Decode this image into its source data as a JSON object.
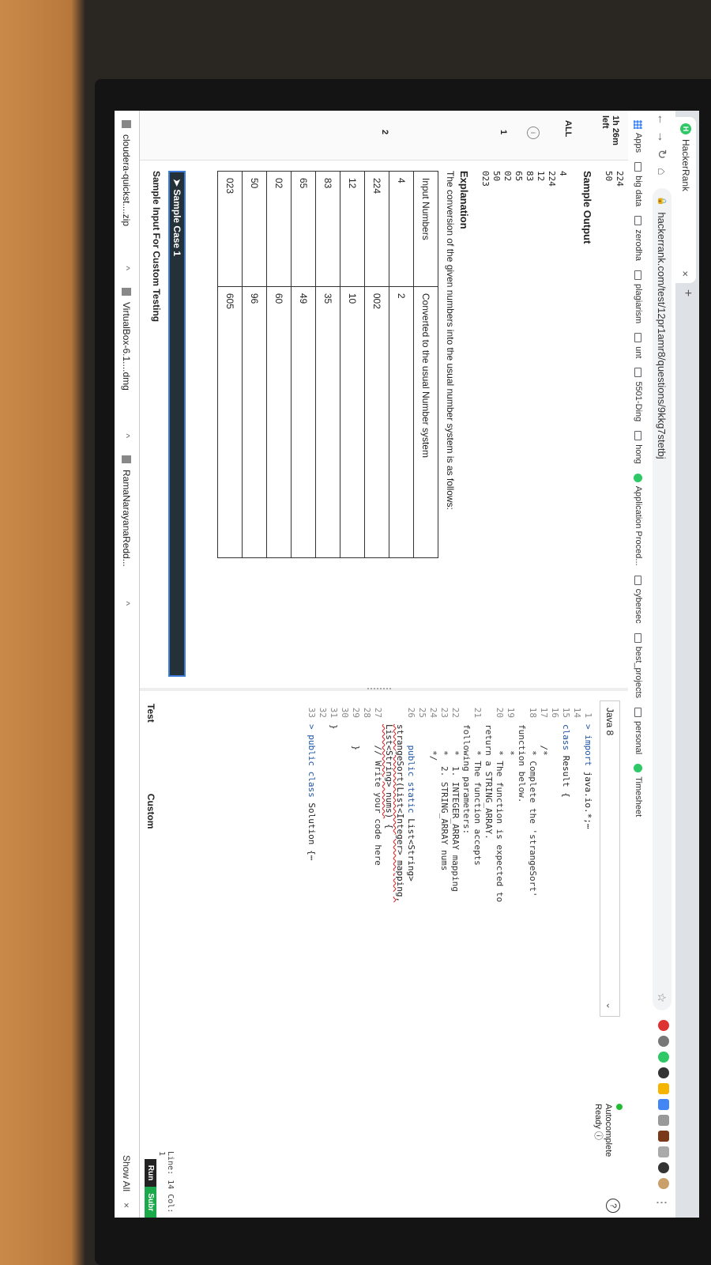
{
  "browser": {
    "tab_title": "HackerRank",
    "tab_close": "×",
    "new_tab": "+",
    "url": "hackerrank.com/test/12pr1amr8/questions/9kkg7stetbj",
    "bookmarks": [
      "Apps",
      "big data",
      "zerodha",
      "plagiarism",
      "unt",
      "5501-Ding",
      "hong",
      "Application Proced...",
      "cybersec",
      "best_projects",
      "personal",
      "Timesheet"
    ]
  },
  "sidebar": {
    "timer": "1h 26m",
    "timer_sub": "left",
    "all_label": "ALL",
    "q1": "1",
    "q2": "2"
  },
  "problem": {
    "top_lines": [
      "224",
      "50"
    ],
    "sample_output_label": "Sample Output",
    "sample_output": [
      "4",
      "224",
      "12",
      "83",
      "65",
      "02",
      "50",
      "023"
    ],
    "explanation_label": "Explanation",
    "explanation_text": "The conversion of the given numbers into the usual number system is as follows:",
    "table_headers": [
      "Input Numbers",
      "Converted to the usual Number system"
    ],
    "table_rows": [
      [
        "4",
        "2"
      ],
      [
        "224",
        "002"
      ],
      [
        "12",
        "10"
      ],
      [
        "83",
        "35"
      ],
      [
        "65",
        "49"
      ],
      [
        "02",
        "60"
      ],
      [
        "50",
        "96"
      ],
      [
        "023",
        "605"
      ]
    ],
    "sample_case": "Sample Case 1",
    "custom_input_label": "Sample Input For Custom Testing"
  },
  "editor": {
    "language": "Java 8",
    "autocomplete": "Autocomplete",
    "autocomplete_status": "Ready",
    "line_info": "Line: 14 Col: 1",
    "tabs": [
      "Test",
      "Custom"
    ],
    "run_label": "Run",
    "submit_label": "Subr"
  },
  "downloads": {
    "items": [
      "cloudera-quickst....zip",
      "VirtualBox-6.1....dmg",
      "RamaNarayanaRedd..."
    ],
    "show_all": "Show All",
    "close": "×"
  },
  "colors": {
    "hackerrank_green": "#2ec866",
    "keyword_blue": "#1b54a8",
    "sample_bar": "#253138"
  }
}
